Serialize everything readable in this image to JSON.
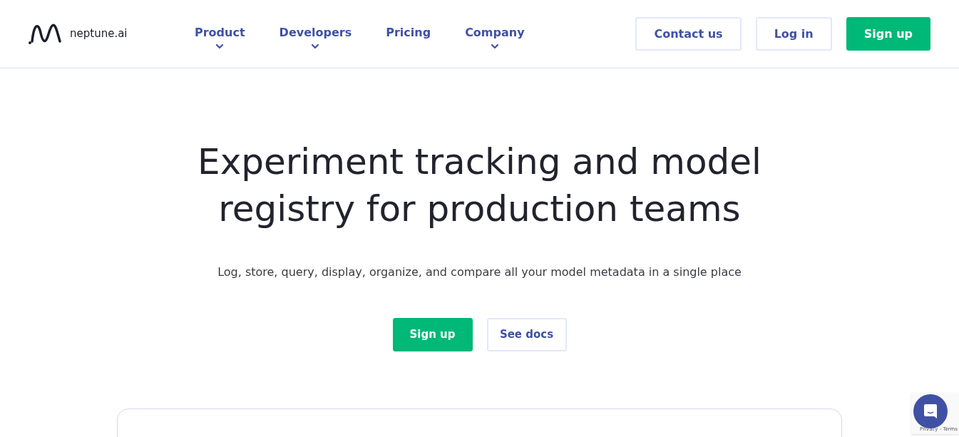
{
  "header": {
    "logo_text": "neptune.ai",
    "nav": [
      {
        "label": "Product",
        "dropdown": true
      },
      {
        "label": "Developers",
        "dropdown": true
      },
      {
        "label": "Pricing",
        "dropdown": false
      },
      {
        "label": "Company",
        "dropdown": true
      }
    ],
    "buttons": [
      {
        "label": "Contact us",
        "kind": "outline"
      },
      {
        "label": "Log in",
        "kind": "outline"
      },
      {
        "label": "Sign up",
        "kind": "primary"
      }
    ]
  },
  "hero": {
    "title": "Experiment tracking and model registry for production teams",
    "subtitle": "Log, store, query, display, organize, and compare all your model metadata in a single place",
    "buttons": [
      {
        "label": "Sign up",
        "kind": "primary"
      },
      {
        "label": "See docs",
        "kind": "outline"
      }
    ]
  },
  "recaptcha": {
    "links": "Privacy - Terms"
  }
}
